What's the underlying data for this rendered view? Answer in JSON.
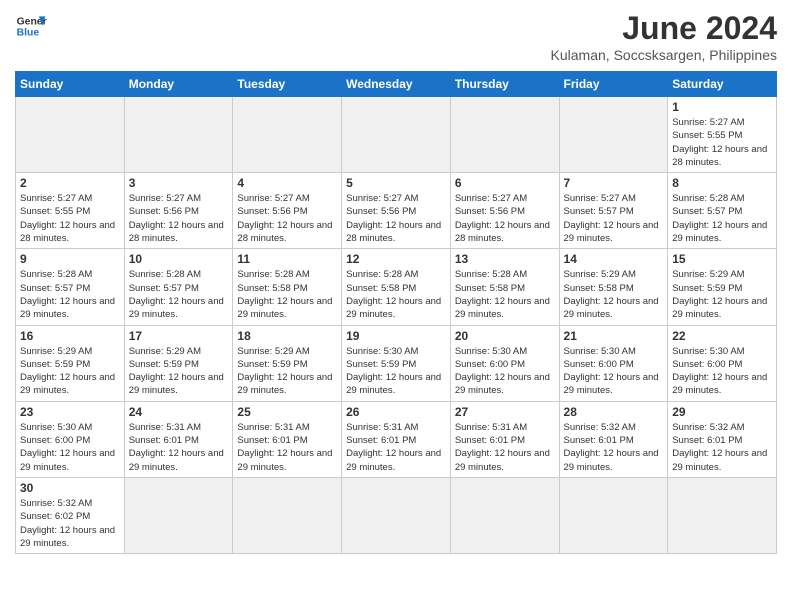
{
  "logo": {
    "line1": "General",
    "line2": "Blue"
  },
  "title": "June 2024",
  "subtitle": "Kulaman, Soccsksargen, Philippines",
  "days_of_week": [
    "Sunday",
    "Monday",
    "Tuesday",
    "Wednesday",
    "Thursday",
    "Friday",
    "Saturday"
  ],
  "weeks": [
    [
      {
        "day": "",
        "empty": true
      },
      {
        "day": "",
        "empty": true
      },
      {
        "day": "",
        "empty": true
      },
      {
        "day": "",
        "empty": true
      },
      {
        "day": "",
        "empty": true
      },
      {
        "day": "",
        "empty": true
      },
      {
        "day": "1",
        "sunrise": "5:27 AM",
        "sunset": "5:55 PM",
        "daylight": "12 hours and 28 minutes."
      }
    ],
    [
      {
        "day": "2",
        "sunrise": "5:27 AM",
        "sunset": "5:55 PM",
        "daylight": "12 hours and 28 minutes."
      },
      {
        "day": "3",
        "sunrise": "5:27 AM",
        "sunset": "5:56 PM",
        "daylight": "12 hours and 28 minutes."
      },
      {
        "day": "4",
        "sunrise": "5:27 AM",
        "sunset": "5:56 PM",
        "daylight": "12 hours and 28 minutes."
      },
      {
        "day": "5",
        "sunrise": "5:27 AM",
        "sunset": "5:56 PM",
        "daylight": "12 hours and 28 minutes."
      },
      {
        "day": "6",
        "sunrise": "5:27 AM",
        "sunset": "5:56 PM",
        "daylight": "12 hours and 28 minutes."
      },
      {
        "day": "7",
        "sunrise": "5:27 AM",
        "sunset": "5:57 PM",
        "daylight": "12 hours and 29 minutes."
      },
      {
        "day": "8",
        "sunrise": "5:28 AM",
        "sunset": "5:57 PM",
        "daylight": "12 hours and 29 minutes."
      }
    ],
    [
      {
        "day": "9",
        "sunrise": "5:28 AM",
        "sunset": "5:57 PM",
        "daylight": "12 hours and 29 minutes."
      },
      {
        "day": "10",
        "sunrise": "5:28 AM",
        "sunset": "5:57 PM",
        "daylight": "12 hours and 29 minutes."
      },
      {
        "day": "11",
        "sunrise": "5:28 AM",
        "sunset": "5:58 PM",
        "daylight": "12 hours and 29 minutes."
      },
      {
        "day": "12",
        "sunrise": "5:28 AM",
        "sunset": "5:58 PM",
        "daylight": "12 hours and 29 minutes."
      },
      {
        "day": "13",
        "sunrise": "5:28 AM",
        "sunset": "5:58 PM",
        "daylight": "12 hours and 29 minutes."
      },
      {
        "day": "14",
        "sunrise": "5:29 AM",
        "sunset": "5:58 PM",
        "daylight": "12 hours and 29 minutes."
      },
      {
        "day": "15",
        "sunrise": "5:29 AM",
        "sunset": "5:59 PM",
        "daylight": "12 hours and 29 minutes."
      }
    ],
    [
      {
        "day": "16",
        "sunrise": "5:29 AM",
        "sunset": "5:59 PM",
        "daylight": "12 hours and 29 minutes."
      },
      {
        "day": "17",
        "sunrise": "5:29 AM",
        "sunset": "5:59 PM",
        "daylight": "12 hours and 29 minutes."
      },
      {
        "day": "18",
        "sunrise": "5:29 AM",
        "sunset": "5:59 PM",
        "daylight": "12 hours and 29 minutes."
      },
      {
        "day": "19",
        "sunrise": "5:30 AM",
        "sunset": "5:59 PM",
        "daylight": "12 hours and 29 minutes."
      },
      {
        "day": "20",
        "sunrise": "5:30 AM",
        "sunset": "6:00 PM",
        "daylight": "12 hours and 29 minutes."
      },
      {
        "day": "21",
        "sunrise": "5:30 AM",
        "sunset": "6:00 PM",
        "daylight": "12 hours and 29 minutes."
      },
      {
        "day": "22",
        "sunrise": "5:30 AM",
        "sunset": "6:00 PM",
        "daylight": "12 hours and 29 minutes."
      }
    ],
    [
      {
        "day": "23",
        "sunrise": "5:30 AM",
        "sunset": "6:00 PM",
        "daylight": "12 hours and 29 minutes."
      },
      {
        "day": "24",
        "sunrise": "5:31 AM",
        "sunset": "6:01 PM",
        "daylight": "12 hours and 29 minutes."
      },
      {
        "day": "25",
        "sunrise": "5:31 AM",
        "sunset": "6:01 PM",
        "daylight": "12 hours and 29 minutes."
      },
      {
        "day": "26",
        "sunrise": "5:31 AM",
        "sunset": "6:01 PM",
        "daylight": "12 hours and 29 minutes."
      },
      {
        "day": "27",
        "sunrise": "5:31 AM",
        "sunset": "6:01 PM",
        "daylight": "12 hours and 29 minutes."
      },
      {
        "day": "28",
        "sunrise": "5:32 AM",
        "sunset": "6:01 PM",
        "daylight": "12 hours and 29 minutes."
      },
      {
        "day": "29",
        "sunrise": "5:32 AM",
        "sunset": "6:01 PM",
        "daylight": "12 hours and 29 minutes."
      }
    ],
    [
      {
        "day": "30",
        "sunrise": "5:32 AM",
        "sunset": "6:02 PM",
        "daylight": "12 hours and 29 minutes."
      },
      {
        "day": "",
        "empty": true
      },
      {
        "day": "",
        "empty": true
      },
      {
        "day": "",
        "empty": true
      },
      {
        "day": "",
        "empty": true
      },
      {
        "day": "",
        "empty": true
      },
      {
        "day": "",
        "empty": true
      }
    ]
  ]
}
